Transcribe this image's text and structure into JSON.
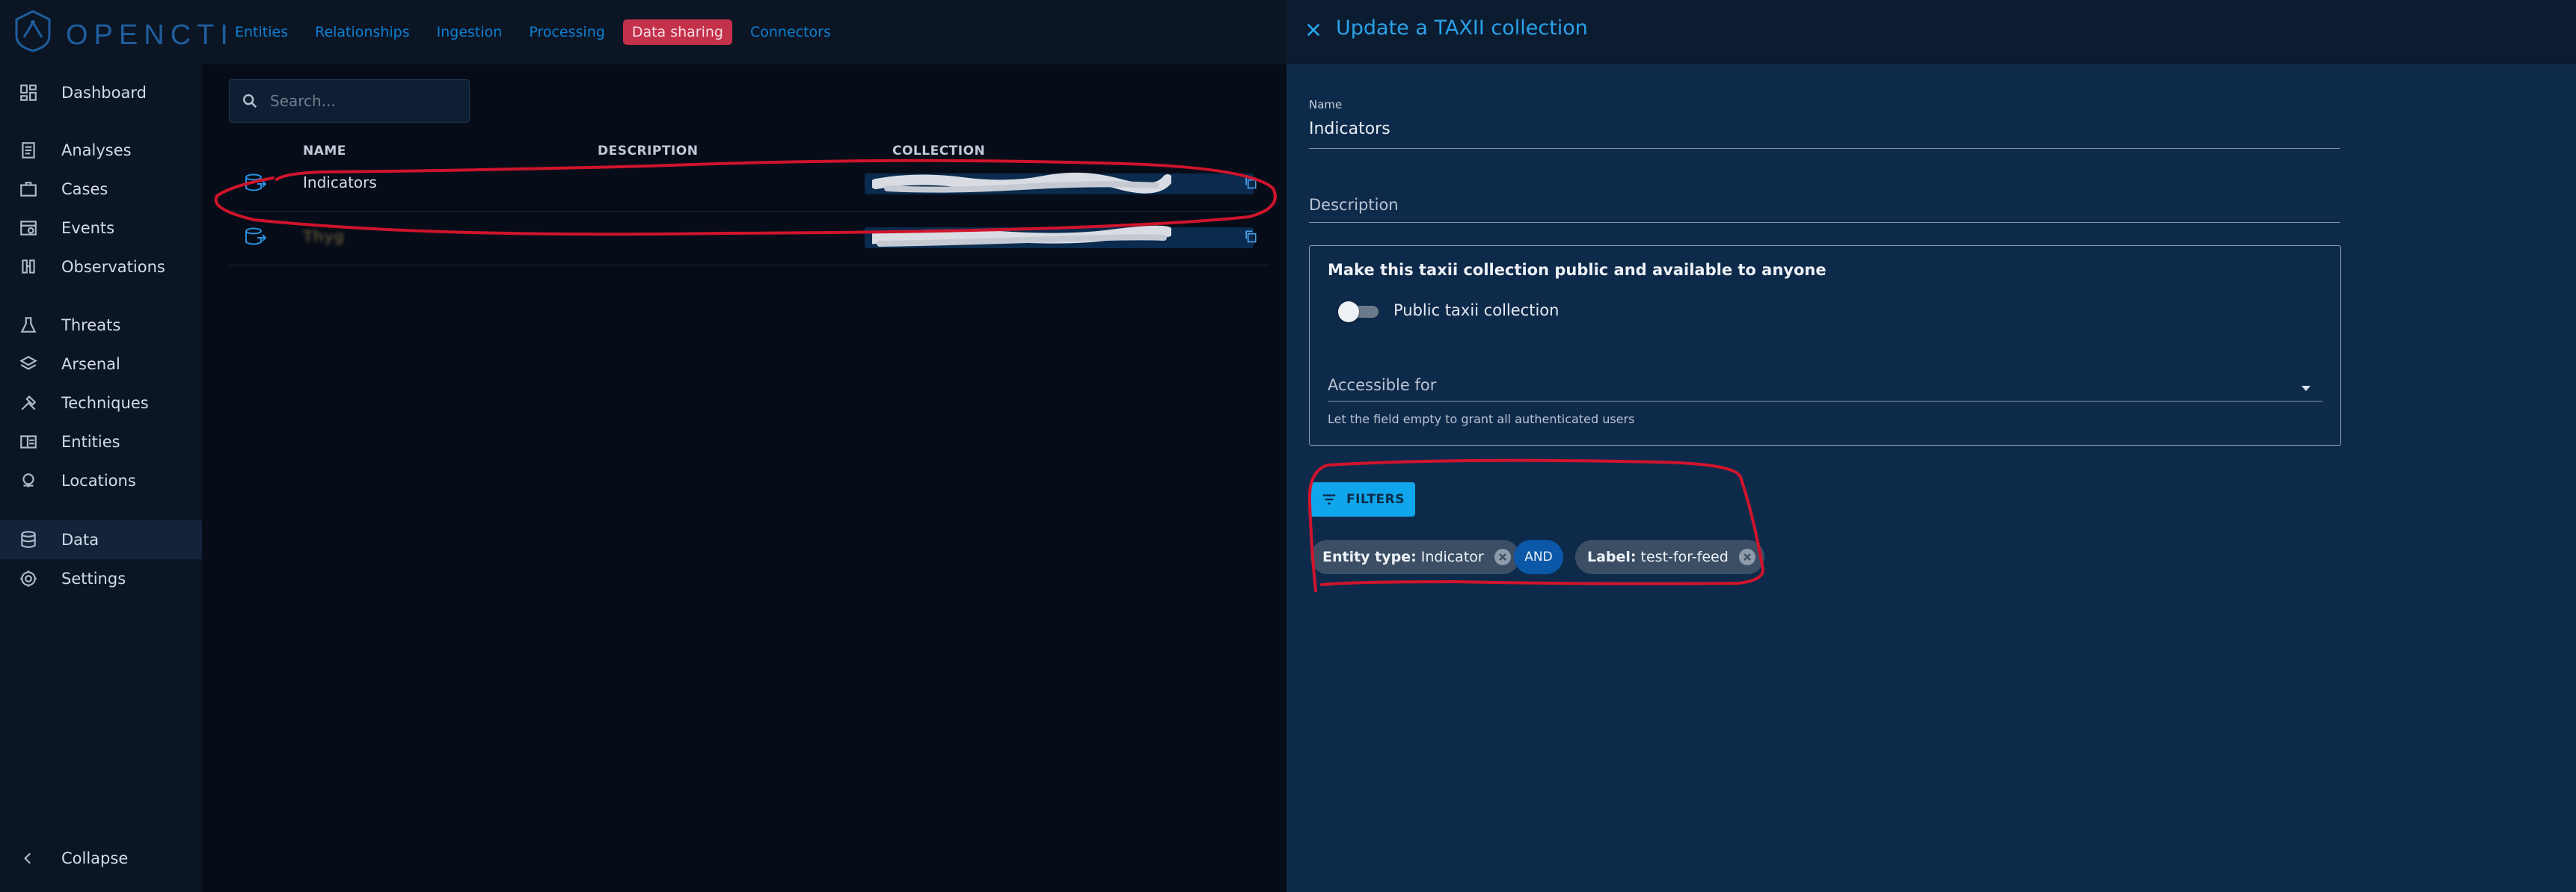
{
  "brand": {
    "logo_text": "OPENCTI"
  },
  "topnav": [
    {
      "label": "Entities",
      "active": false
    },
    {
      "label": "Relationships",
      "active": false
    },
    {
      "label": "Ingestion",
      "active": false
    },
    {
      "label": "Processing",
      "active": false
    },
    {
      "label": "Data sharing",
      "active": true
    },
    {
      "label": "Connectors",
      "active": false
    }
  ],
  "sidebar": {
    "groups": [
      [
        {
          "label": "Dashboard",
          "icon": "dashboard-icon"
        }
      ],
      [
        {
          "label": "Analyses",
          "icon": "analyses-icon"
        },
        {
          "label": "Cases",
          "icon": "cases-icon"
        },
        {
          "label": "Events",
          "icon": "events-icon"
        },
        {
          "label": "Observations",
          "icon": "observations-icon"
        }
      ],
      [
        {
          "label": "Threats",
          "icon": "threats-icon"
        },
        {
          "label": "Arsenal",
          "icon": "arsenal-icon"
        },
        {
          "label": "Techniques",
          "icon": "techniques-icon"
        },
        {
          "label": "Entities",
          "icon": "entities-icon"
        },
        {
          "label": "Locations",
          "icon": "locations-icon"
        }
      ],
      [
        {
          "label": "Data",
          "icon": "data-icon",
          "active": true
        },
        {
          "label": "Settings",
          "icon": "settings-icon"
        }
      ]
    ],
    "collapse_label": "Collapse"
  },
  "list": {
    "search_placeholder": "Search...",
    "columns": [
      "NAME",
      "DESCRIPTION",
      "COLLECTION"
    ],
    "rows": [
      {
        "name": "Indicators",
        "description": "",
        "collection_redacted": true
      },
      {
        "name": "Thyg",
        "description": "",
        "collection_redacted": true
      }
    ]
  },
  "drawer": {
    "title": "Update a TAXII collection",
    "name_label": "Name",
    "name_value": "Indicators",
    "description_label": "Description",
    "public_title": "Make this taxii collection public and available to anyone",
    "public_toggle_label": "Public taxii collection",
    "public_toggle_on": false,
    "accessible_label": "Accessible for",
    "accessible_help": "Let the field empty to grant all authenticated users",
    "filters_label": "FILTERS",
    "filters": [
      {
        "key": "Entity type:",
        "value": "Indicator"
      },
      {
        "key": "Label:",
        "value": "test-for-feed"
      }
    ],
    "operator": "AND"
  },
  "colors": {
    "accent": "#0fa6ec",
    "active_tab": "#c4314b",
    "annotation": "#d0142c",
    "drawer_bg": "#0e2a4a"
  }
}
